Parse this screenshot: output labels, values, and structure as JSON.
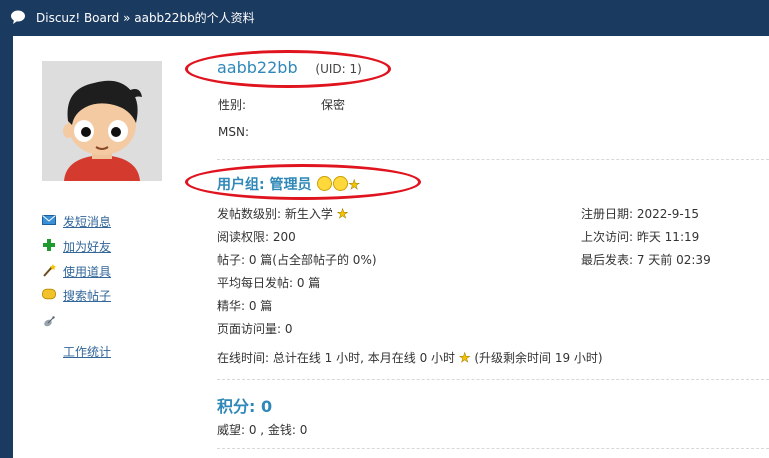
{
  "breadcrumb": {
    "site": "Discuz! Board",
    "separator": "»",
    "page": "aabb22bb的个人资料"
  },
  "profile": {
    "username": "aabb22bb",
    "uid": "(UID: 1)",
    "gender_label": "性别:",
    "gender_value": "保密",
    "msn_label": "MSN:"
  },
  "sidebar": {
    "items": [
      {
        "label": "发短消息",
        "icon": "mail-icon"
      },
      {
        "label": "加为好友",
        "icon": "add-friend-icon"
      },
      {
        "label": "使用道具",
        "icon": "magic-wand-icon"
      },
      {
        "label": "搜索帖子",
        "icon": "search-posts-icon"
      },
      {
        "label": "",
        "icon": "satellite-icon"
      },
      {
        "label": "工作统计",
        "icon": ""
      }
    ]
  },
  "group": {
    "title": "用户组: 管理员"
  },
  "stats": {
    "post_level": "发帖数级别: 新生入学",
    "read_perm": "阅读权限: 200",
    "posts": "帖子: 0 篇(占全部帖子的 0%)",
    "avg_daily": "平均每日发帖: 0 篇",
    "digest": "精华: 0 篇",
    "page_views": "页面访问量: 0",
    "online_time": "在线时间: 总计在线 1 小时, 本月在线 0 小时",
    "upgrade_remaining": "(升级剩余时间 19 小时)",
    "reg_date": "注册日期: 2022-9-15",
    "last_visit": "上次访问: 昨天 11:19",
    "last_post": "最后发表: 7 天前 02:39"
  },
  "score": {
    "title": "积分: 0",
    "details": "威望: 0 , 金钱: 0"
  },
  "colors": {
    "header_bg": "#1b3a60",
    "link": "#336699",
    "accent": "#2f88b8",
    "annotation": "#e0141e"
  }
}
